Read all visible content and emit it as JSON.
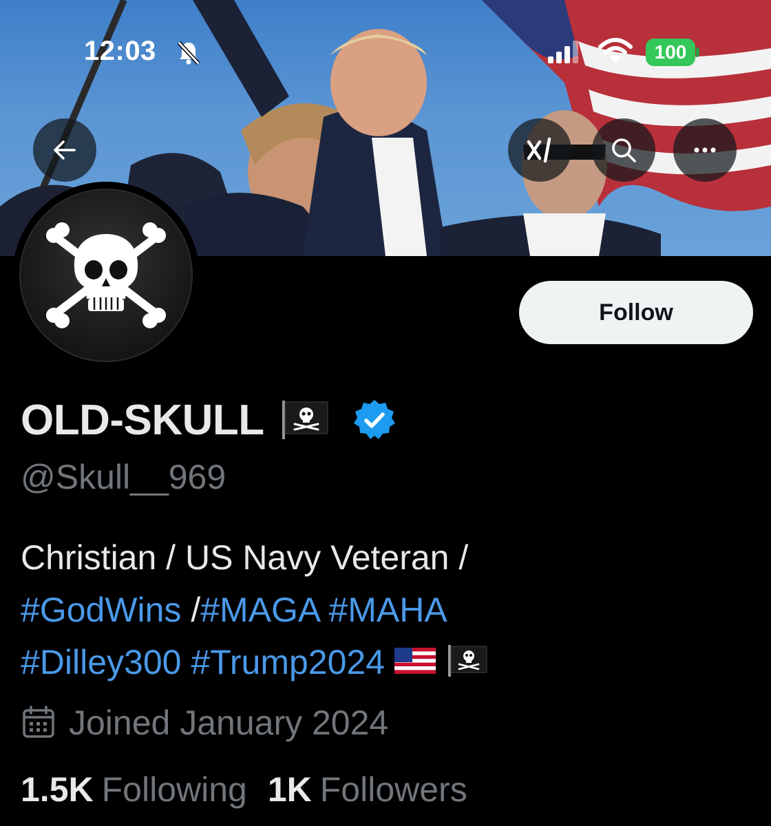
{
  "status_bar": {
    "time": "12:03",
    "battery": "100",
    "battery_color": "#34c759"
  },
  "header": {
    "back_icon": "arrow-left-icon",
    "grok_icon": "grok-icon",
    "grok_label": "xI",
    "search_icon": "search-icon",
    "more_icon": "more-dots-icon"
  },
  "profile": {
    "display_name": "OLD-SKULL",
    "handle": "@Skull__969",
    "follow_label": "Follow",
    "bio": {
      "line1": "Christian / US Navy Veteran /",
      "line2_tag1": "#GodWins",
      "line2_sep": " /",
      "line2_tag2": "#MAGA",
      "line2_tag3": "#MAHA",
      "line3_tag1": "#Dilley300",
      "line3_tag2": "#Trump2024"
    },
    "joined": "Joined January 2024",
    "following_count": "1.5K",
    "following_label": "Following",
    "followers_count": "1K",
    "followers_label": "Followers"
  },
  "colors": {
    "link": "#4a99e9",
    "muted": "#71767b",
    "verified": "#1d9bf0"
  }
}
